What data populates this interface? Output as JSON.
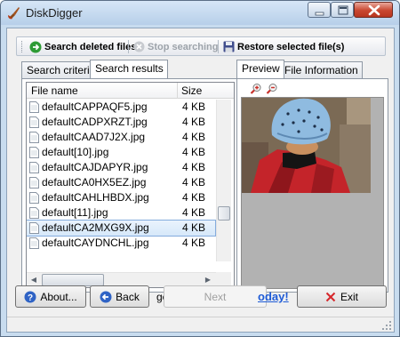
{
  "window": {
    "title": "DiskDigger",
    "colors": {
      "titlebar": "#c9dbef",
      "close": "#c9462f",
      "selection": "#d6e8fa",
      "link": "#1e5bd6"
    }
  },
  "toolbar": {
    "search_label": "Search deleted files",
    "stop_label": "Stop searching",
    "restore_label": "Restore selected file(s)"
  },
  "left_tabs": [
    {
      "label": "Search criteria"
    },
    {
      "label": "Search results"
    }
  ],
  "right_tabs": [
    {
      "label": "Preview"
    },
    {
      "label": "File Information"
    }
  ],
  "results": {
    "columns": {
      "name": "File name",
      "size": "Size"
    },
    "rows": [
      {
        "name": "defaultCAPPAQF5.jpg",
        "size": "4 KB"
      },
      {
        "name": "defaultCADPXRZT.jpg",
        "size": "4 KB"
      },
      {
        "name": "defaultCAAD7J2X.jpg",
        "size": "4 KB"
      },
      {
        "name": "default[10].jpg",
        "size": "4 KB"
      },
      {
        "name": "defaultCAJDAPYR.jpg",
        "size": "4 KB"
      },
      {
        "name": "defaultCA0HX5EZ.jpg",
        "size": "4 KB"
      },
      {
        "name": "defaultCAHLHBDX.jpg",
        "size": "4 KB"
      },
      {
        "name": "default[11].jpg",
        "size": "4 KB"
      },
      {
        "name": "defaultCA2MXG9X.jpg",
        "size": "4 KB"
      },
      {
        "name": "defaultCAYDNCHL.jpg",
        "size": "4 KB"
      }
    ],
    "selected_index": 8,
    "vertical_scroll_position": 0.72
  },
  "buttons": {
    "about": "About...",
    "back": "Back",
    "next": "Next",
    "exit": "Exit"
  },
  "behind_text": "ge",
  "today_link": "oday!"
}
